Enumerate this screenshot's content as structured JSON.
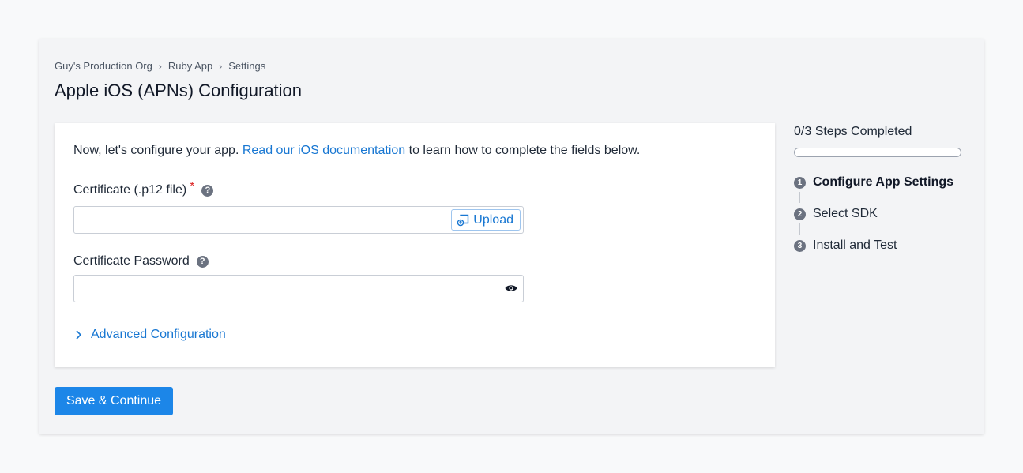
{
  "breadcrumb": {
    "items": [
      "Guy's Production Org",
      "Ruby App",
      "Settings"
    ],
    "separator": "›"
  },
  "page": {
    "title": "Apple iOS (APNs) Configuration"
  },
  "intro": {
    "prefix": "Now, let's configure your app.",
    "link": "Read our iOS documentation",
    "suffix": "to learn how to complete the fields below."
  },
  "certificate": {
    "label": "Certificate (.p12 file)",
    "required_mark": "*",
    "help": "?",
    "value": "",
    "upload_label": "Upload"
  },
  "password": {
    "label": "Certificate Password",
    "help": "?",
    "value": ""
  },
  "advanced": {
    "label": "Advanced Configuration"
  },
  "actions": {
    "save_label": "Save & Continue"
  },
  "progress": {
    "summary": "0/3 Steps Completed",
    "completed": 0,
    "total": 3,
    "steps": [
      {
        "number": "1",
        "label": "Configure App Settings",
        "active": true
      },
      {
        "number": "2",
        "label": "Select SDK",
        "active": false
      },
      {
        "number": "3",
        "label": "Install and Test",
        "active": false
      }
    ]
  },
  "colors": {
    "accent": "#1c86e8",
    "link": "#1877d2",
    "required": "#dc2626"
  }
}
